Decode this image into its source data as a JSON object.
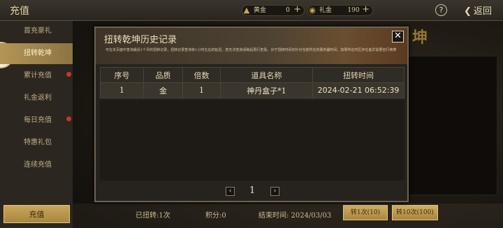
{
  "topbar": {
    "title": "充值",
    "gold_label": "黄金",
    "gold_value": "0",
    "gift_label": "礼金",
    "gift_value": "190",
    "help": "?",
    "back": "返回"
  },
  "sidebar": {
    "items": [
      {
        "label": "首充豪礼",
        "active": false,
        "dot": false
      },
      {
        "label": "扭转乾坤",
        "active": true,
        "dot": false
      },
      {
        "label": "累计充值",
        "active": false,
        "dot": true
      },
      {
        "label": "礼金返利",
        "active": false,
        "dot": false
      },
      {
        "label": "每日充值",
        "active": false,
        "dot": true
      },
      {
        "label": "特惠礼包",
        "active": false,
        "dot": false
      },
      {
        "label": "连续充值",
        "active": false,
        "dot": false
      }
    ],
    "recharge_button": "充值"
  },
  "background": {
    "big_char": "坤"
  },
  "bottom": {
    "twisted": "已扭转:1次",
    "points": "积分:0",
    "end_time": "结束时间: 2024/03/03",
    "btn_once": "转1次(10)",
    "btn_ten": "转10次(100)"
  },
  "modal": {
    "title": "扭转乾坤历史记录",
    "notice": "可在本页面中查询最近1个月的扭转记录，扭转记录查询有1小时左右的延迟。若无法查询请稍后再行查看，对于扭转时间仅针对当前所在的服务器时间，如果所在时区存在差异需要自行换算",
    "close": "✕",
    "columns": [
      "序号",
      "品质",
      "倍数",
      "道具名称",
      "扭转时间"
    ],
    "rows": [
      [
        "1",
        "金",
        "1",
        "神丹盒子*1",
        "2024-02-21 06:52:39"
      ]
    ],
    "pager": {
      "prev": "‹",
      "page": "1",
      "next": "›"
    }
  }
}
